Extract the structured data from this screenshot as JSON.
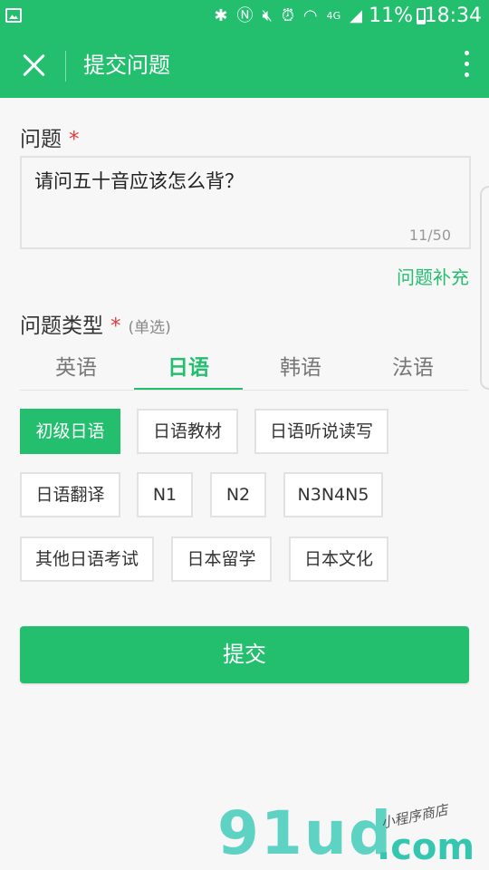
{
  "status_bar": {
    "icons": [
      "bluetooth-icon",
      "nfc-icon",
      "mute-icon",
      "alarm-icon",
      "wifi-icon",
      "4g-signal-icon"
    ],
    "network": "4G",
    "battery": "11%",
    "time": "18:34"
  },
  "app_bar": {
    "title": "提交问题"
  },
  "question": {
    "label": "问题",
    "required_mark": "*",
    "value": "请问五十音应该怎么背？",
    "counter": "11/50",
    "supplement_link": "问题补充"
  },
  "question_type": {
    "label": "问题类型",
    "required_mark": "*",
    "hint": "(单选)",
    "tabs": [
      {
        "label": "英语",
        "active": false
      },
      {
        "label": "日语",
        "active": true
      },
      {
        "label": "韩语",
        "active": false
      },
      {
        "label": "法语",
        "active": false
      }
    ],
    "options": [
      {
        "label": "初级日语",
        "selected": true
      },
      {
        "label": "日语教材",
        "selected": false
      },
      {
        "label": "日语听说读写",
        "selected": false
      },
      {
        "label": "日语翻译",
        "selected": false
      },
      {
        "label": "N1",
        "selected": false
      },
      {
        "label": "N2",
        "selected": false
      },
      {
        "label": "N3N4N5",
        "selected": false
      },
      {
        "label": "其他日语考试",
        "selected": false
      },
      {
        "label": "日本留学",
        "selected": false
      },
      {
        "label": "日本文化",
        "selected": false
      }
    ]
  },
  "submit_label": "提交",
  "watermark": {
    "main": "91ud",
    "domain": ".com",
    "sub": "小程序商店"
  },
  "colors": {
    "primary": "#23bf6f",
    "required": "#e23b3b"
  }
}
